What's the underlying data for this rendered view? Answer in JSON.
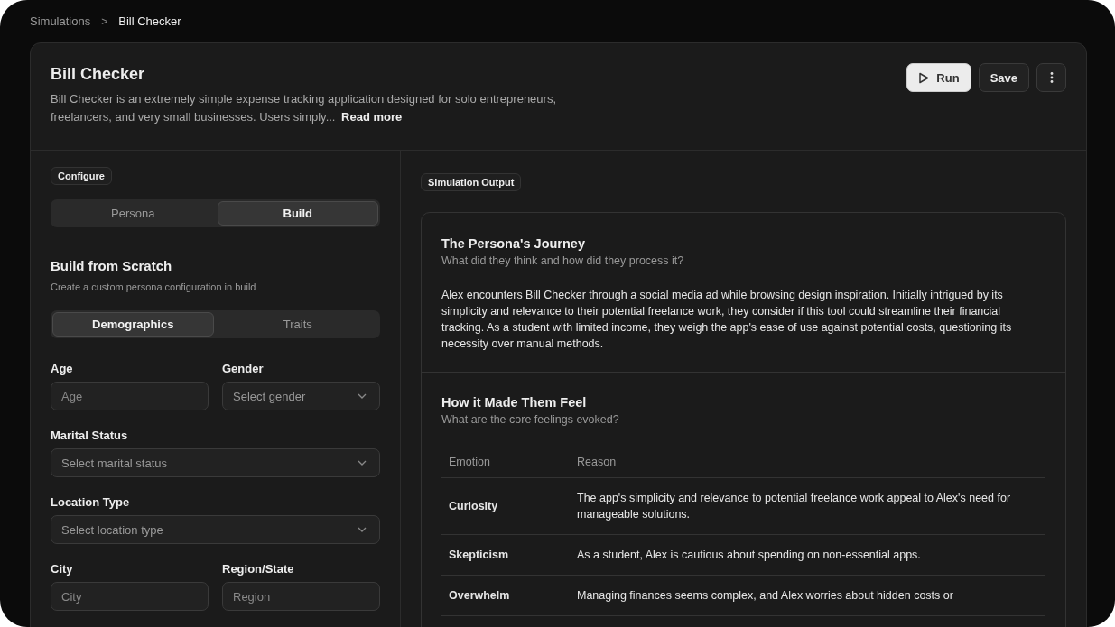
{
  "breadcrumb": [
    {
      "label": "Simulations",
      "current": false
    },
    {
      "label": "Bill Checker",
      "current": true
    }
  ],
  "breadcrumb_separator": ">",
  "header": {
    "title": "Bill Checker",
    "description": "Bill Checker is an extremely simple expense tracking application designed for solo entrepreneurs, freelancers, and very small businesses. Users simply...",
    "read_more": "Read more"
  },
  "actions": [
    {
      "label": "Run",
      "kind": "primary"
    },
    {
      "label": "Save",
      "kind": "secondary"
    },
    {
      "kind": "more"
    }
  ],
  "configure": {
    "badge": "Configure",
    "mode_tabs": [
      {
        "label": "Persona",
        "selected": false
      },
      {
        "label": "Build",
        "selected": true
      }
    ],
    "title": "Build from Scratch",
    "subtitle": "Create a custom persona configuration in build",
    "section_tabs": [
      {
        "label": "Demographics",
        "selected": true
      },
      {
        "label": "Traits",
        "selected": false
      }
    ],
    "rows": [
      {
        "fields": [
          {
            "label": "Age",
            "kind": "input",
            "placeholder": "Age"
          },
          {
            "label": "Gender",
            "kind": "select",
            "placeholder": "Select gender"
          }
        ]
      },
      {
        "fields": [
          {
            "label": "Marital Status",
            "kind": "select",
            "placeholder": "Select marital status"
          }
        ]
      },
      {
        "fields": [
          {
            "label": "Location Type",
            "kind": "select",
            "placeholder": "Select location type"
          }
        ]
      },
      {
        "fields": [
          {
            "label": "City",
            "kind": "input",
            "placeholder": "City"
          },
          {
            "label": "Region/State",
            "kind": "input",
            "placeholder": "Region"
          }
        ]
      }
    ]
  },
  "output": {
    "badge": "Simulation Output",
    "journey": {
      "title": "The Persona's Journey",
      "subtitle": "What did they think and how did they process it?",
      "text": "Alex encounters Bill Checker through a social media ad while browsing design inspiration. Initially intrigued by its simplicity and relevance to their potential freelance work, they consider if this tool could streamline their financial tracking. As a student with limited income, they weigh the app's ease of use against potential costs, questioning its necessity over manual methods."
    },
    "feelings": {
      "title": "How it Made Them Feel",
      "subtitle": "What are the core feelings evoked?",
      "columns": [
        "Emotion",
        "Reason"
      ],
      "rows": [
        {
          "emotion": "Curiosity",
          "reason": "The app's simplicity and relevance to potential freelance work appeal to Alex's need for manageable solutions."
        },
        {
          "emotion": "Skepticism",
          "reason": "As a student, Alex is cautious about spending on non-essential apps."
        },
        {
          "emotion": "Overwhelm",
          "reason": "Managing finances seems complex, and Alex worries about hidden costs or"
        }
      ]
    }
  }
}
